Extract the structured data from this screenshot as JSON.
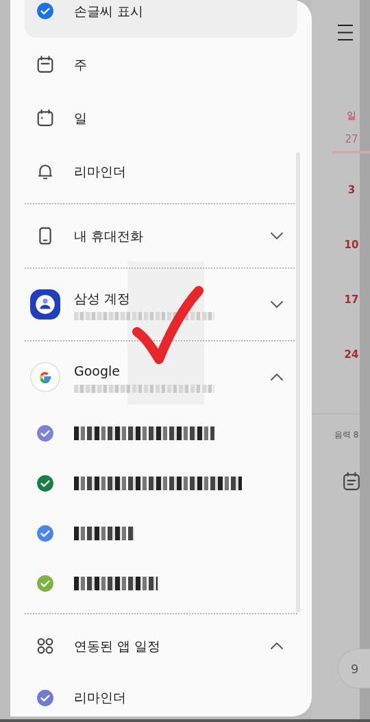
{
  "drawer": {
    "top_items": [
      {
        "kind": "checkbox",
        "label": "손글씨 표시",
        "checked": true,
        "selected": true
      },
      {
        "kind": "week",
        "label": "주",
        "selected": false
      },
      {
        "kind": "day",
        "label": "일",
        "selected": false
      },
      {
        "kind": "bell",
        "label": "리마인더",
        "selected": false
      }
    ],
    "accounts": [
      {
        "kind": "phone",
        "label": "내 휴대전화",
        "expanded": false
      },
      {
        "kind": "samsung",
        "label": "삼성 계정",
        "expanded": false,
        "masked_subtitle": true
      },
      {
        "kind": "google",
        "label": "Google",
        "expanded": true,
        "masked_subtitle": true,
        "calendars": [
          {
            "color": "#7b83d6",
            "masked": true
          },
          {
            "color": "#1a7f46",
            "masked": true
          },
          {
            "color": "#4a86e8",
            "masked": true
          },
          {
            "color": "#7cb342",
            "masked": true
          }
        ]
      },
      {
        "kind": "apps",
        "label": "연동된 앱 일정",
        "expanded": true,
        "calendars": [
          {
            "color": "#6f7bd6",
            "label": "리마인더"
          }
        ]
      }
    ]
  },
  "calendar": {
    "weekday": "일",
    "dates": [
      {
        "label": "27",
        "muted": true
      },
      {
        "label": "3",
        "muted": false
      },
      {
        "label": "10",
        "muted": false
      },
      {
        "label": "17",
        "muted": false
      },
      {
        "label": "24",
        "muted": false
      }
    ],
    "lunar": "음력 8",
    "month_button": "9"
  },
  "annotation": {
    "kind": "check"
  }
}
